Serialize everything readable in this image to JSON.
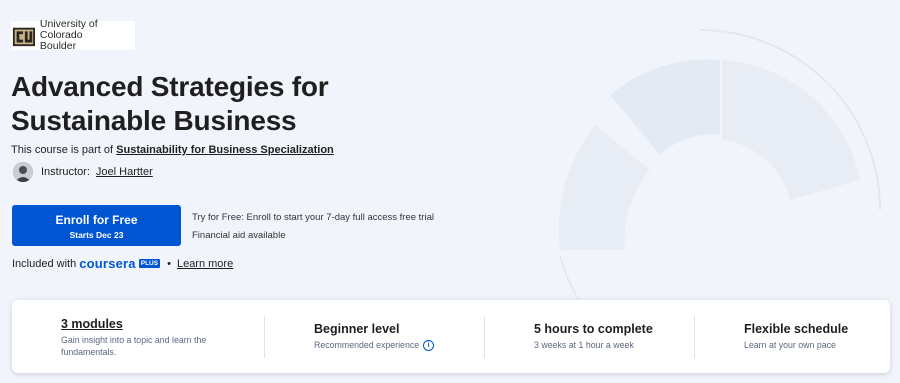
{
  "partner": {
    "name": "University of Colorado\nBoulder"
  },
  "course": {
    "title": "Advanced Strategies for Sustainable Business",
    "part_of_prefix": "This course is part of ",
    "specialization": "Sustainability for Business Specialization"
  },
  "instructor": {
    "label": "Instructor:",
    "name": "Joel Hartter"
  },
  "enroll": {
    "label": "Enroll for Free",
    "subtext": "Starts Dec 23"
  },
  "trial": {
    "text": "Try for Free: Enroll to start your 7-day full access free trial",
    "financial_aid": "Financial aid available"
  },
  "included": {
    "prefix": "Included with",
    "brand": "coursera",
    "badge": "PLUS",
    "separator": "•",
    "learn_more": "Learn more"
  },
  "info": [
    {
      "title": "3 modules",
      "subtitle": "Gain insight into a topic and learn the fundamentals."
    },
    {
      "title": "Beginner level",
      "subtitle": "Recommended experience"
    },
    {
      "title": "5 hours to complete",
      "subtitle": "3 weeks at 1 hour a week"
    },
    {
      "title": "Flexible schedule",
      "subtitle": "Learn at your own pace"
    }
  ],
  "colors": {
    "brand_blue": "#0056d2",
    "hero_background": "#f1f5fb"
  },
  "icons": [
    "cu-logo-icon",
    "info-icon"
  ]
}
